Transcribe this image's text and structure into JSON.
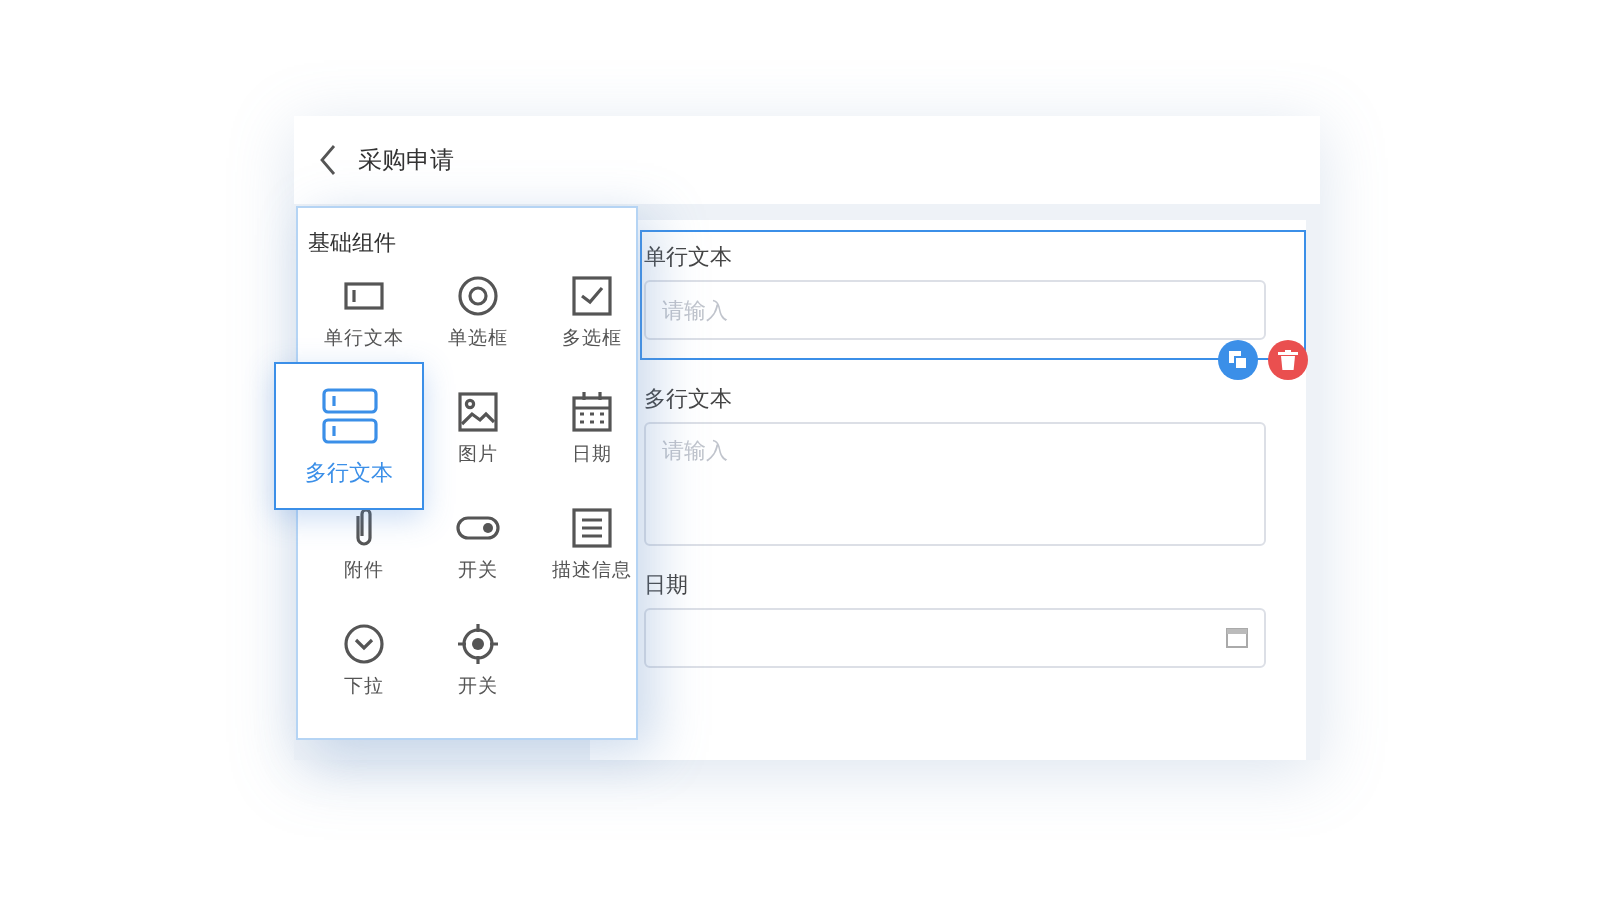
{
  "header": {
    "title": "采购申请"
  },
  "palette": {
    "title": "基础组件",
    "items": [
      {
        "label": "单行文本",
        "kind": "textbox"
      },
      {
        "label": "单选框",
        "kind": "radio"
      },
      {
        "label": "多选框",
        "kind": "checkbox"
      },
      {
        "label": "图片",
        "kind": "image"
      },
      {
        "label": "日期",
        "kind": "calendar"
      },
      {
        "label": "附件",
        "kind": "attachment"
      },
      {
        "label": "开关",
        "kind": "toggle"
      },
      {
        "label": "描述信息",
        "kind": "description"
      },
      {
        "label": "下拉",
        "kind": "dropdown"
      },
      {
        "label": "开关",
        "kind": "target"
      }
    ],
    "dragging": {
      "label": "多行文本",
      "kind": "multiline"
    }
  },
  "form": {
    "fields": [
      {
        "label": "单行文本",
        "kind": "single",
        "placeholder": "请输入",
        "selected": true
      },
      {
        "label": "多行文本",
        "kind": "multi",
        "placeholder": "请输入",
        "selected": false
      },
      {
        "label": "日期",
        "kind": "date",
        "selected": false
      }
    ]
  }
}
